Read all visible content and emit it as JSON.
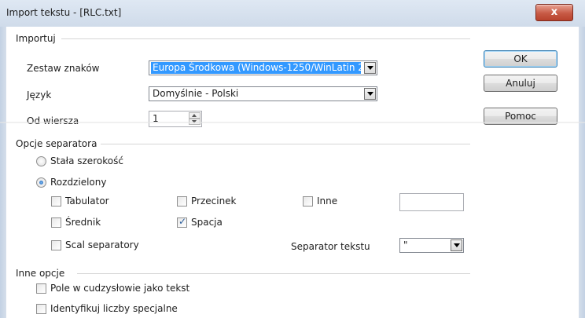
{
  "window": {
    "title": "Import tekstu - [RLC.txt]",
    "close_glyph": "x"
  },
  "import": {
    "heading": "Importuj",
    "charset_label": "Zestaw znaków",
    "charset_value": "Europa Środkowa (Windows-1250/WinLatin 2)",
    "language_label": "Język",
    "language_value": "Domyślnie - Polski",
    "from_row_label": "Od wiersza",
    "from_row_value": "1"
  },
  "buttons": {
    "ok": "OK",
    "cancel": "Anuluj",
    "help": "Pomoc"
  },
  "separator_options": {
    "heading": "Opcje separatora",
    "fixed_width": {
      "label": "Stała szerokość",
      "selected": false
    },
    "separated": {
      "label": "Rozdzielony",
      "selected": true
    },
    "tab": {
      "label": "Tabulator",
      "checked": false
    },
    "comma": {
      "label": "Przecinek",
      "checked": false
    },
    "other": {
      "label": "Inne",
      "checked": false,
      "value": ""
    },
    "semicolon": {
      "label": "Średnik",
      "checked": false
    },
    "space": {
      "label": "Spacja",
      "checked": true
    },
    "merge": {
      "label": "Scal separatory",
      "checked": false
    },
    "text_separator_label": "Separator tekstu",
    "text_separator_value": "\""
  },
  "other_options": {
    "heading": "Inne opcje",
    "quoted_as_text": {
      "label": "Pole w cudzysłowie jako tekst",
      "checked": false
    },
    "detect_special": {
      "label": "Identyfikuj liczby specjalne",
      "checked": false
    }
  },
  "colors": {
    "selection": "#3399ff",
    "titlebar": "#d6e1ef",
    "close": "#c75a45"
  }
}
